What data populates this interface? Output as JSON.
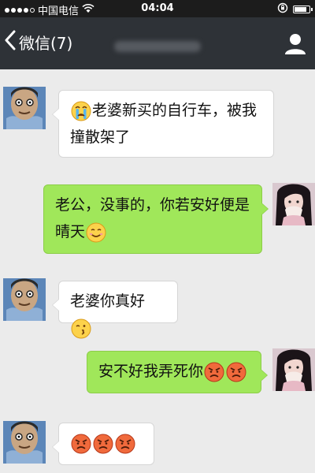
{
  "status_bar": {
    "carrier": "中国电信",
    "time": "04:04",
    "battery_level": 0.85
  },
  "nav": {
    "back_label": "微信(7)"
  },
  "messages": [
    {
      "direction": "in",
      "emoji_before": [
        "crying-face-icon"
      ],
      "text": "老婆新买的自行车，被我撞散架了",
      "emoji_after": []
    },
    {
      "direction": "out",
      "text": "老公，没事的，你若安好便是晴天",
      "emoji_after": [
        "smiling-face-icon"
      ]
    },
    {
      "direction": "in",
      "text": "老婆你真好",
      "emoji_after": [
        "kissing-face-icon"
      ]
    },
    {
      "direction": "out",
      "text": "安不好我弄死你",
      "emoji_after": [
        "angry-face-icon",
        "angry-face-icon"
      ]
    },
    {
      "direction": "in",
      "text": "",
      "emoji_after": [
        "angry-face-icon",
        "angry-face-icon",
        "angry-face-icon"
      ]
    }
  ],
  "colors": {
    "incoming_bubble": "#ffffff",
    "outgoing_bubble": "#a0e75a",
    "nav_bar": "#2e3237",
    "background": "#ebebeb"
  }
}
